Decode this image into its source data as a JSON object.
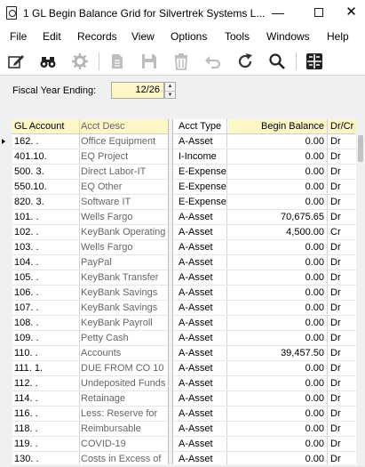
{
  "window": {
    "title": "1 GL Begin Balance Grid for Silvertrek Systems L...",
    "minimize": "—",
    "close": "✕"
  },
  "menu": [
    "File",
    "Edit",
    "Records",
    "View",
    "Options",
    "Tools",
    "Windows",
    "Help"
  ],
  "toolbar": [
    "edit-icon",
    "find-binoculars-icon",
    "process-gear-icon",
    "document-icon",
    "save-icon",
    "delete-icon",
    "undo-icon",
    "refresh-icon",
    "search-icon",
    "layout-grid-icon"
  ],
  "fiscal": {
    "label": "Fiscal Year Ending:",
    "value": "12/26",
    "up": "▲",
    "down": "▼"
  },
  "columns": {
    "account": "GL Account",
    "desc": "Acct Desc",
    "type": "Acct Type",
    "balance": "Begin Balance",
    "drcr": "Dr/Cr"
  },
  "rows": [
    {
      "account": "162.  .",
      "desc": "Office Equipment",
      "type": "A-Asset",
      "balance": "0.00",
      "drcr": "Dr"
    },
    {
      "account": "401.10.",
      "desc": "EQ Project",
      "type": "I-Income",
      "balance": "0.00",
      "drcr": "Dr"
    },
    {
      "account": "500. 3.",
      "desc": "Direct Labor-IT",
      "type": "E-Expense",
      "balance": "0.00",
      "drcr": "Dr"
    },
    {
      "account": "550.10.",
      "desc": "EQ Other",
      "type": "E-Expense",
      "balance": "0.00",
      "drcr": "Dr"
    },
    {
      "account": "820. 3.",
      "desc": "Software IT",
      "type": "E-Expense",
      "balance": "0.00",
      "drcr": "Dr"
    },
    {
      "account": "101.  .",
      "desc": "Wells Fargo",
      "type": "A-Asset",
      "balance": "70,675.65",
      "drcr": "Dr"
    },
    {
      "account": "102.  .",
      "desc": "KeyBank Operating",
      "type": "A-Asset",
      "balance": "4,500.00",
      "drcr": "Cr"
    },
    {
      "account": "103.  .",
      "desc": "Wells Fargo",
      "type": "A-Asset",
      "balance": "0.00",
      "drcr": "Dr"
    },
    {
      "account": "104.  .",
      "desc": "PayPal",
      "type": "A-Asset",
      "balance": "0.00",
      "drcr": "Dr"
    },
    {
      "account": "105.  .",
      "desc": "KeyBank Transfer",
      "type": "A-Asset",
      "balance": "0.00",
      "drcr": "Dr"
    },
    {
      "account": "106.  .",
      "desc": "KeyBank Savings",
      "type": "A-Asset",
      "balance": "0.00",
      "drcr": "Dr"
    },
    {
      "account": "107.  .",
      "desc": "KeyBank Savings",
      "type": "A-Asset",
      "balance": "0.00",
      "drcr": "Dr"
    },
    {
      "account": "108.  .",
      "desc": "KeyBank Payroll",
      "type": "A-Asset",
      "balance": "0.00",
      "drcr": "Dr"
    },
    {
      "account": "109.  .",
      "desc": "Petty Cash",
      "type": "A-Asset",
      "balance": "0.00",
      "drcr": "Dr"
    },
    {
      "account": "110.  .",
      "desc": "Accounts",
      "type": "A-Asset",
      "balance": "39,457.50",
      "drcr": "Dr"
    },
    {
      "account": "111. 1.",
      "desc": "DUE FROM CO 10",
      "type": "A-Asset",
      "balance": "0.00",
      "drcr": "Dr"
    },
    {
      "account": "112.  .",
      "desc": "Undeposited Funds",
      "type": "A-Asset",
      "balance": "0.00",
      "drcr": "Dr"
    },
    {
      "account": "114.  .",
      "desc": "Retainage",
      "type": "A-Asset",
      "balance": "0.00",
      "drcr": "Dr"
    },
    {
      "account": "116.  .",
      "desc": "Less: Reserve for",
      "type": "A-Asset",
      "balance": "0.00",
      "drcr": "Dr"
    },
    {
      "account": "118.  .",
      "desc": "Reimbursable",
      "type": "A-Asset",
      "balance": "0.00",
      "drcr": "Dr"
    },
    {
      "account": "119.  .",
      "desc": "COVID-19",
      "type": "A-Asset",
      "balance": "0.00",
      "drcr": "Dr"
    },
    {
      "account": "130.  .",
      "desc": "Costs in Excess of",
      "type": "A-Asset",
      "balance": "0.00",
      "drcr": "Dr"
    }
  ]
}
